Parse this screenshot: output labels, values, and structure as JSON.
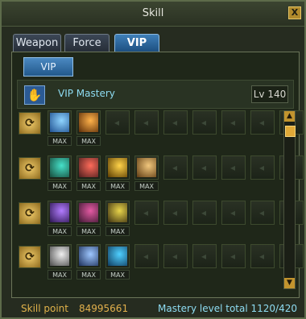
{
  "window": {
    "title": "Skill",
    "close_symbol": "X"
  },
  "tabs": [
    "Weapon",
    "Force",
    "VIP"
  ],
  "active_tab": "VIP",
  "subtab": "VIP",
  "mastery": {
    "label": "VIP Mastery",
    "level": "Lv 140",
    "icon": "hand-icon"
  },
  "max_label": "MAX",
  "rows": [
    {
      "skills": [
        {
          "icon": "blue-wave-skill-icon",
          "colors": [
            "#1e4f8f",
            "#8fd4ff"
          ]
        },
        {
          "icon": "orange-slash-skill-icon",
          "colors": [
            "#5a2c08",
            "#ffb24a"
          ]
        }
      ]
    },
    {
      "skills": [
        {
          "icon": "cyan-dragon-skill-icon",
          "colors": [
            "#164b3a",
            "#46e1c9"
          ]
        },
        {
          "icon": "red-pillar-skill-icon",
          "colors": [
            "#4b1d1d",
            "#ff6b5a"
          ]
        },
        {
          "icon": "golden-beam-skill-icon",
          "colors": [
            "#5a3b00",
            "#ffd34a"
          ]
        },
        {
          "icon": "spiral-skill-icon",
          "colors": [
            "#5e3b12",
            "#f1c77d"
          ]
        }
      ]
    },
    {
      "skills": [
        {
          "icon": "purple-slash-skill-icon",
          "colors": [
            "#2b154f",
            "#b27cff"
          ]
        },
        {
          "icon": "dark-rune-skill-icon",
          "colors": [
            "#3b1830",
            "#e45aa3"
          ]
        },
        {
          "icon": "skull-skill-icon",
          "colors": [
            "#3a2e10",
            "#e8d44a"
          ]
        }
      ]
    },
    {
      "skills": [
        {
          "icon": "glasses-mask-skill-icon",
          "colors": [
            "#4a4a4a",
            "#f0f0f0"
          ]
        },
        {
          "icon": "spark-slash-skill-icon",
          "colors": [
            "#1c2f5a",
            "#9ec7ff"
          ]
        },
        {
          "icon": "blue-bird-skill-icon",
          "colors": [
            "#0f3b5e",
            "#4fd0ff"
          ]
        }
      ]
    }
  ],
  "footer": {
    "skill_point_label": "Skill point",
    "skill_point_value": "84995661",
    "mastery_total": "Mastery level total 1120/420"
  }
}
